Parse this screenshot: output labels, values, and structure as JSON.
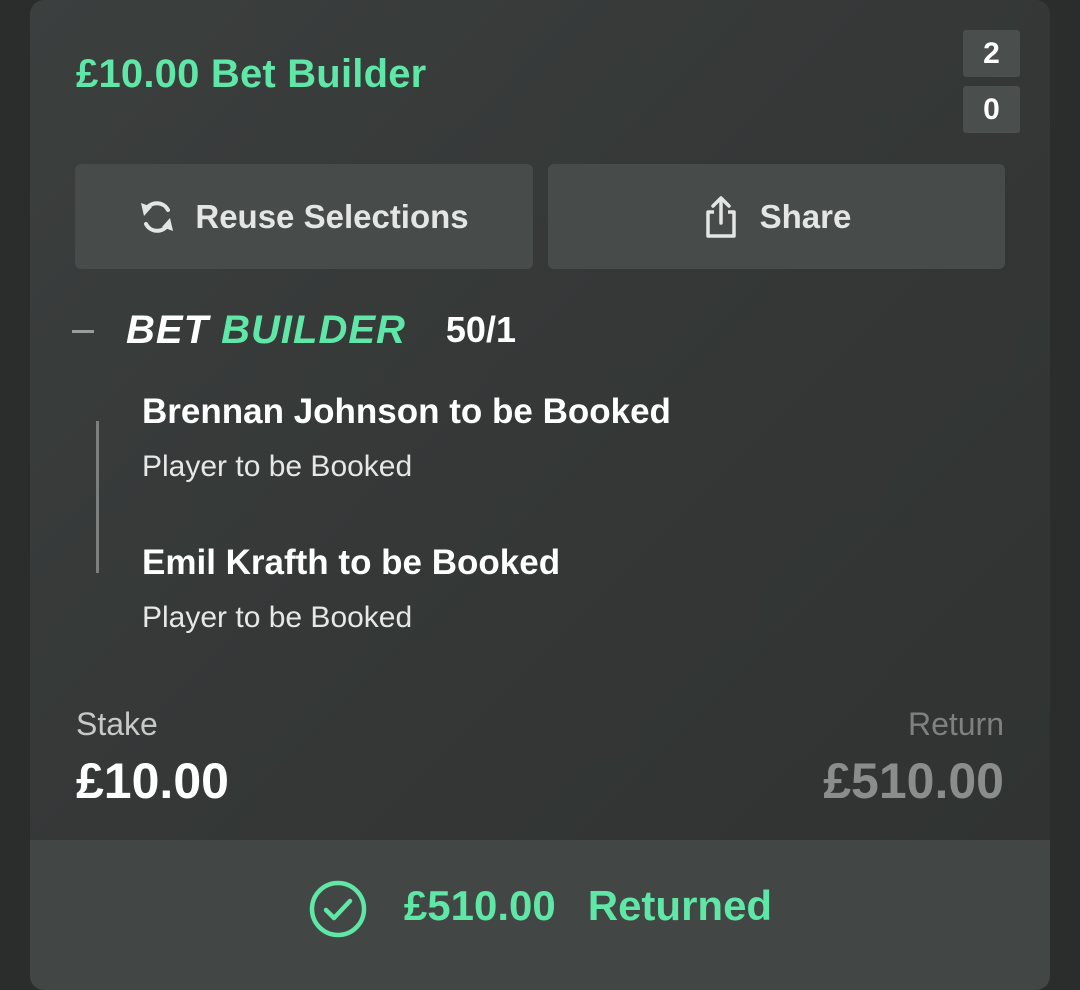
{
  "bet": {
    "title": "£10.00 Bet Builder",
    "score": {
      "home": "2",
      "away": "0"
    }
  },
  "actions": {
    "reuse_label": "Reuse Selections",
    "share_label": "Share"
  },
  "bet_builder": {
    "logo_word1": "BET",
    "logo_word2": "BUILDER",
    "odds": "50/1",
    "selections": [
      {
        "title": "Brennan Johnson to be Booked",
        "market": "Player to be Booked"
      },
      {
        "title": "Emil Krafth to be Booked",
        "market": "Player to be Booked"
      }
    ]
  },
  "summary": {
    "stake_label": "Stake",
    "stake_value": "£10.00",
    "return_label": "Return",
    "return_value": "£510.00"
  },
  "result": {
    "amount": "£510.00",
    "status": "Returned"
  },
  "icons": {
    "reuse": "refresh-icon",
    "share": "share-icon",
    "result": "check-circle-icon"
  },
  "colors": {
    "accent": "#5ee7a6",
    "card_bg": "#383b3a",
    "button_bg": "#474b49",
    "muted_text": "#8a8d8c"
  }
}
